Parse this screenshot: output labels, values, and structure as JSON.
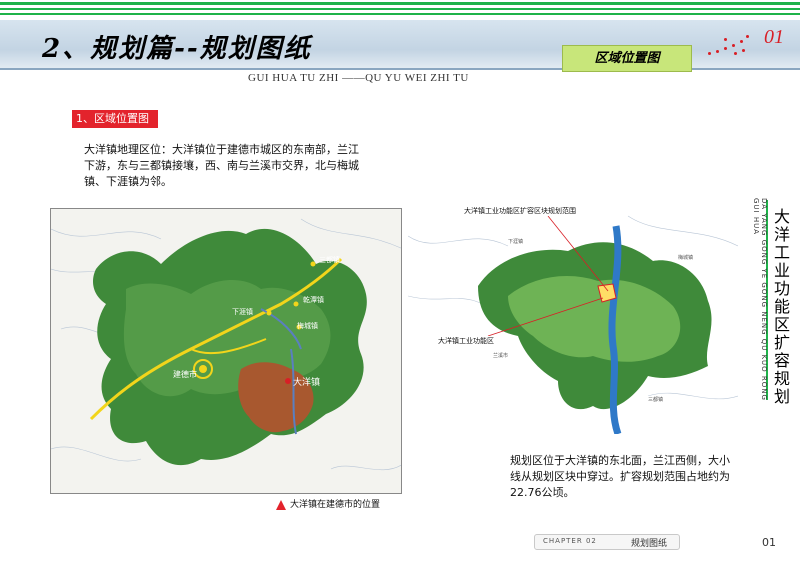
{
  "header": {
    "title": "2、规划篇--规划图纸",
    "pinyin": "GUI HUA TU ZHI ——QU YU WEI ZHI TU",
    "section_badge": "区域位置图",
    "page_number": "01"
  },
  "section": {
    "heading": "1、区域位置图",
    "description": "大洋镇地理区位：大洋镇位于建德市城区的东南部，兰江下游，东与三都镇接壤，西、南与兰溪市交界，北与梅城镇、下涯镇为邻。"
  },
  "left_map": {
    "labels": {
      "jiande": "建德市",
      "dayang": "大洋镇",
      "meicheng": "梅城镇",
      "xiaya": "下涯镇",
      "sandu": "三都镇",
      "qiantan": "乾潭镇"
    },
    "legend": "大洋镇在建德市的位置"
  },
  "right_map": {
    "callout_expansion": "大洋镇工业功能区扩容区块规划范围",
    "callout_zone": "大洋镇工业功能区",
    "small_labels": {
      "xiaya": "下涯镇",
      "meicheng": "梅城镇",
      "lanxi": "兰溪市",
      "sandu": "三都镇",
      "xinan": "新安江街道",
      "gengluo": "更楼街道",
      "dayang": "大洋镇",
      "dazhou": "大殿镇",
      "lanshan": "兰溪市"
    },
    "description": "规划区位于大洋镇的东北面，兰江西侧，大小线从规划区块中穿过。扩容规划范围占地约为22.76公顷。"
  },
  "side_title": {
    "chinese": "大洋工业功能区扩容规划",
    "pinyin": "DA YANG GONG YE GONG NENG QU KUO RONG GUI HUA"
  },
  "footer": {
    "chapter": "CHAPTER  02",
    "label": "规划图纸",
    "page": "01"
  },
  "colors": {
    "accent_red": "#e3232c",
    "stripe_green": "#1fb34a",
    "badge_green": "#c8e67a"
  }
}
